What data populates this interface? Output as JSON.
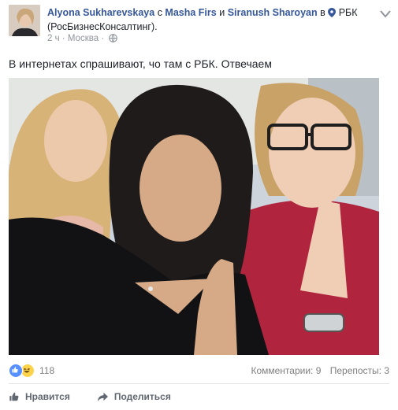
{
  "header": {
    "author": "Alyona Sukharevskaya",
    "with_word": "с",
    "tagged_1": "Masha Firs",
    "and_word": "и",
    "tagged_2": "Siranush Sharoyan",
    "in_word": "в",
    "place": "РБК (РосБизнесКонсалтинг).",
    "time": "2 ч",
    "separator": "·",
    "location": "Москва",
    "separator2": "·"
  },
  "post": {
    "text": "В интернетах спрашивают, чо там с РБК. Отвечаем"
  },
  "stats": {
    "reaction_count": "118",
    "comments": "Комментарии: 9",
    "shares": "Перепосты: 3"
  },
  "actions": {
    "like_label": "Нравится",
    "share_label": "Поделиться"
  },
  "icons": {
    "avatar": "avatar-photo",
    "location": "location-pin-icon",
    "audience": "globe-icon",
    "menu": "chevron-down-icon",
    "like_reaction": "thumbs-up-icon",
    "haha_reaction": "haha-face-icon",
    "like_action": "thumbs-up-outline-icon",
    "share_action": "share-arrow-icon"
  },
  "colors": {
    "link": "#365899",
    "muted": "#90949c",
    "like_blue": "#5890ff",
    "haha_yellow": "#fcd34a"
  }
}
